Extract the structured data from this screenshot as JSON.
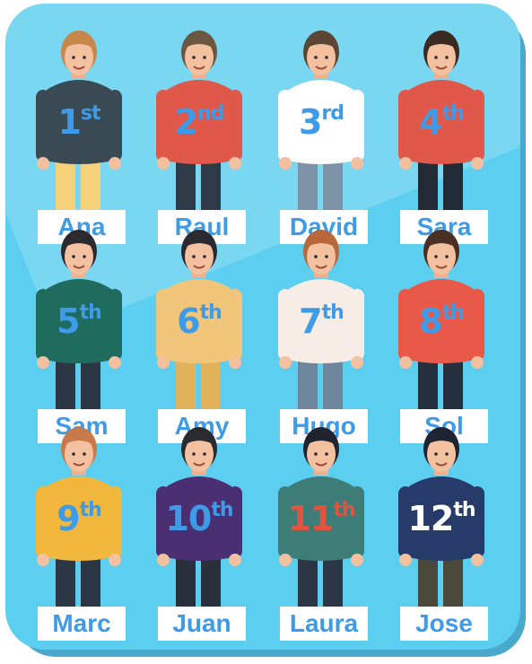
{
  "colors": {
    "background": "#5ccff0",
    "frame_shadow": "#49a8cc",
    "label_text": "#3e9be8",
    "label_bg": "#ffffff",
    "ordinal_default": "#3e9be8",
    "ordinal_red": "#e2533f",
    "ordinal_white": "#ffffff"
  },
  "people": [
    {
      "name": "Ana",
      "ordinal_number": "1",
      "ordinal_suffix": "st",
      "shirt": "#3a4a55",
      "pants": "#f5d27a",
      "hair": "#c8874a"
    },
    {
      "name": "Raul",
      "ordinal_number": "2",
      "ordinal_suffix": "nd",
      "shirt": "#e0584a",
      "pants": "#2f3a48",
      "hair": "#6b5640"
    },
    {
      "name": "David",
      "ordinal_number": "3",
      "ordinal_suffix": "rd",
      "shirt": "#ffffff",
      "pants": "#7e93a8",
      "hair": "#5b4634"
    },
    {
      "name": "Sara",
      "ordinal_number": "4",
      "ordinal_suffix": "th",
      "shirt": "#e0584a",
      "pants": "#222a36",
      "hair": "#3a2a22"
    },
    {
      "name": "Sam",
      "ordinal_number": "5",
      "ordinal_suffix": "th",
      "shirt": "#1f6b5e",
      "pants": "#2c3644",
      "hair": "#2a2a30"
    },
    {
      "name": "Amy",
      "ordinal_number": "6",
      "ordinal_suffix": "th",
      "shirt": "#f1c57a",
      "pants": "#e2b35a",
      "hair": "#2a2a30"
    },
    {
      "name": "Hugo",
      "ordinal_number": "7",
      "ordinal_suffix": "th",
      "shirt": "#f7ece6",
      "pants": "#6f879c",
      "hair": "#b8683a"
    },
    {
      "name": "Sol",
      "ordinal_number": "8",
      "ordinal_suffix": "th",
      "shirt": "#e8594a",
      "pants": "#24303e",
      "hair": "#4a2f24"
    },
    {
      "name": "Marc",
      "ordinal_number": "9",
      "ordinal_suffix": "th",
      "shirt": "#f2b73d",
      "pants": "#2c3644",
      "hair": "#c77a4a"
    },
    {
      "name": "Juan",
      "ordinal_number": "10",
      "ordinal_suffix": "th",
      "shirt": "#4b2f73",
      "pants": "#2a2f3c",
      "hair": "#2a2a30"
    },
    {
      "name": "Laura",
      "ordinal_number": "11",
      "ordinal_suffix": "th",
      "shirt": "#3e7c78",
      "pants": "#2c3644",
      "hair": "#1f2430",
      "ordinal_color": "red"
    },
    {
      "name": "Jose",
      "ordinal_number": "12",
      "ordinal_suffix": "th",
      "shirt": "#263b6a",
      "pants": "#4b4a3a",
      "hair": "#1f2430",
      "ordinal_color": "white"
    }
  ]
}
